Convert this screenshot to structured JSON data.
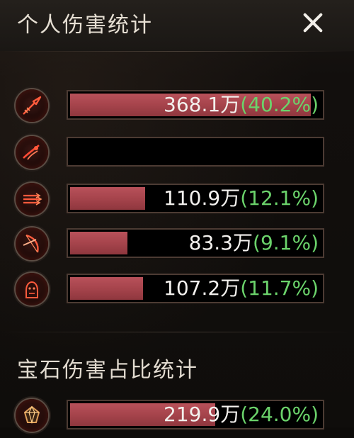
{
  "header": {
    "title": "个人伤害统计",
    "close_icon": "close-icon"
  },
  "personal_damage": {
    "rows": [
      {
        "icon": "arrow-strike-icon",
        "value": "368.1万",
        "percent": "(40.2%)",
        "fill": 0.96
      },
      {
        "icon": "dash-strike-icon",
        "value": "",
        "percent": "",
        "fill": 0.0
      },
      {
        "icon": "multi-arrow-icon",
        "value": "110.9万",
        "percent": "(12.1%)",
        "fill": 0.3
      },
      {
        "icon": "bow-icon",
        "value": "83.3万",
        "percent": "(9.1%)",
        "fill": 0.23
      },
      {
        "icon": "beast-icon",
        "value": "107.2万",
        "percent": "(11.7%)",
        "fill": 0.29
      }
    ]
  },
  "gem_damage": {
    "title": "宝石伤害占比统计",
    "rows": [
      {
        "icon": "gem-icon",
        "value": "219.9万",
        "percent": "(24.0%)",
        "fill": 0.58
      }
    ]
  },
  "colors": {
    "bar_fill": "#a6444c",
    "percent_text": "#6bd36b",
    "value_text": "#f3f1ee"
  }
}
